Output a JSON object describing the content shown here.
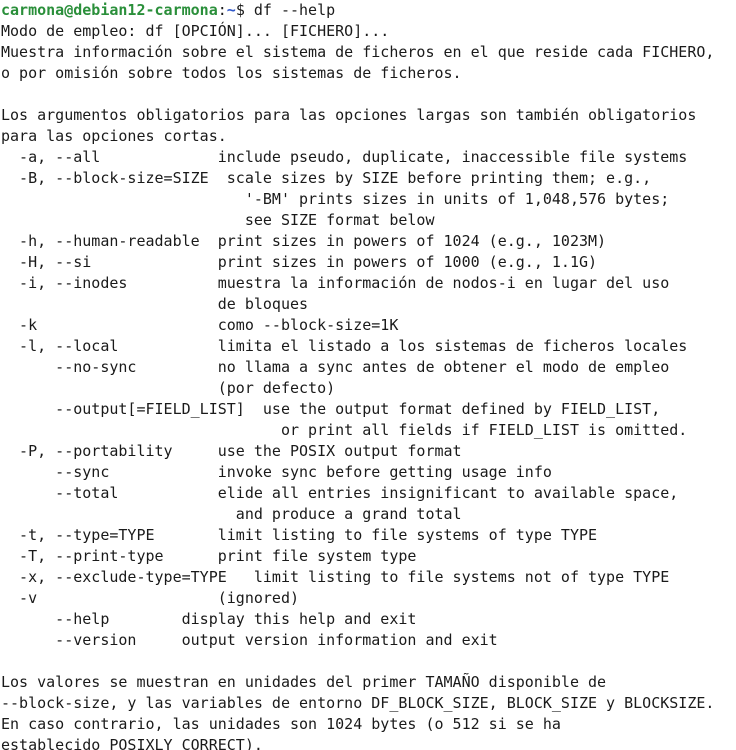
{
  "prompt": {
    "user_host": "carmona@debian12-carmona",
    "separator": ":",
    "path": "~",
    "symbol": "$ ",
    "command": "df --help"
  },
  "output_lines": [
    "Modo de empleo: df [OPCIÓN]... [FICHERO]...",
    "Muestra información sobre el sistema de ficheros en el que reside cada FICHERO,",
    "o por omisión sobre todos los sistemas de ficheros.",
    "",
    "Los argumentos obligatorios para las opciones largas son también obligatorios",
    "para las opciones cortas.",
    "  -a, --all             include pseudo, duplicate, inaccessible file systems",
    "  -B, --block-size=SIZE  scale sizes by SIZE before printing them; e.g.,",
    "                           '-BM' prints sizes in units of 1,048,576 bytes;",
    "                           see SIZE format below",
    "  -h, --human-readable  print sizes in powers of 1024 (e.g., 1023M)",
    "  -H, --si              print sizes in powers of 1000 (e.g., 1.1G)",
    "  -i, --inodes          muestra la información de nodos-i en lugar del uso",
    "                        de bloques",
    "  -k                    como --block-size=1K",
    "  -l, --local           limita el listado a los sistemas de ficheros locales",
    "      --no-sync         no llama a sync antes de obtener el modo de empleo",
    "                        (por defecto)",
    "      --output[=FIELD_LIST]  use the output format defined by FIELD_LIST,",
    "                               or print all fields if FIELD_LIST is omitted.",
    "  -P, --portability     use the POSIX output format",
    "      --sync            invoke sync before getting usage info",
    "      --total           elide all entries insignificant to available space,",
    "                          and produce a grand total",
    "  -t, --type=TYPE       limit listing to file systems of type TYPE",
    "  -T, --print-type      print file system type",
    "  -x, --exclude-type=TYPE   limit listing to file systems not of type TYPE",
    "  -v                    (ignored)",
    "      --help        display this help and exit",
    "      --version     output version information and exit",
    "",
    "Los valores se muestran en unidades del primer TAMAÑO disponible de",
    "--block-size, y las variables de entorno DF_BLOCK_SIZE, BLOCK_SIZE y BLOCKSIZE.",
    "En caso contrario, las unidades son 1024 bytes (o 512 si se ha",
    "establecido POSIXLY_CORRECT)."
  ]
}
